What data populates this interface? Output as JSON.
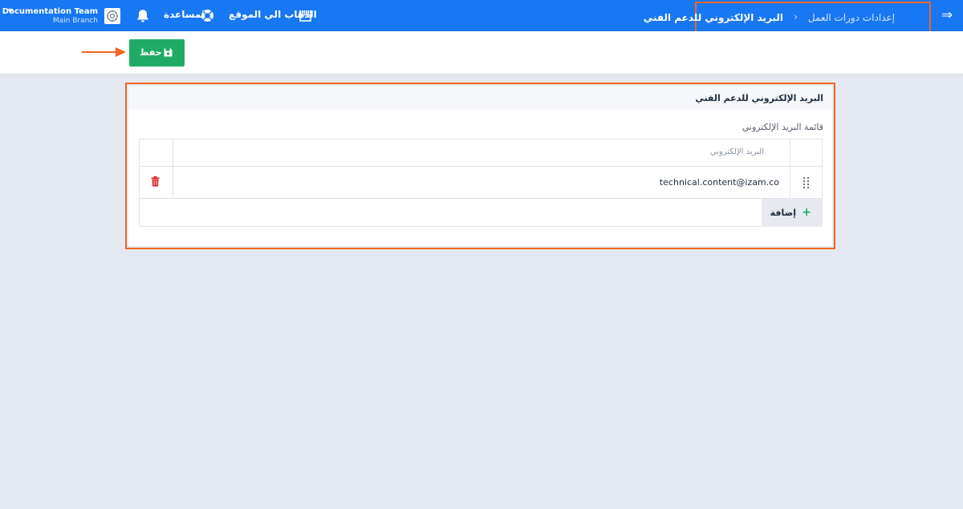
{
  "topbar": {
    "breadcrumb_parent": "إعدادات دورات العمل",
    "breadcrumb_separator": "›",
    "breadcrumb_current": "البريد الإلكتروني للدعم الفني",
    "go_to_site": "الذهاب الي الموقع",
    "help": "المساعدة",
    "account_name": "Documentation Team",
    "branch_name": "Main Branch"
  },
  "actionbar": {
    "save_label": "حفظ"
  },
  "panel": {
    "title": "البريد الإلكتروني للدعم الفني",
    "list_label": "قائمة البريد الإلكتروني",
    "column_header": "البريد الإلكتروني",
    "rows": [
      {
        "email": "technical.content@izam.co"
      }
    ],
    "add_label": "إضافة"
  },
  "colors": {
    "topbar": "#1877f2",
    "annotation": "#f26522",
    "primary_green": "#1fab66",
    "delete_red": "#e02424",
    "page_background": "#e4e9f1"
  },
  "icons": {
    "menu": "arrow-right-icon",
    "store": "store-icon",
    "help": "lifebuoy-icon",
    "notifications": "bell-icon",
    "save": "floppy-disk-icon",
    "drag": "drag-handle-icon",
    "delete": "trash-icon",
    "add": "plus-icon"
  }
}
